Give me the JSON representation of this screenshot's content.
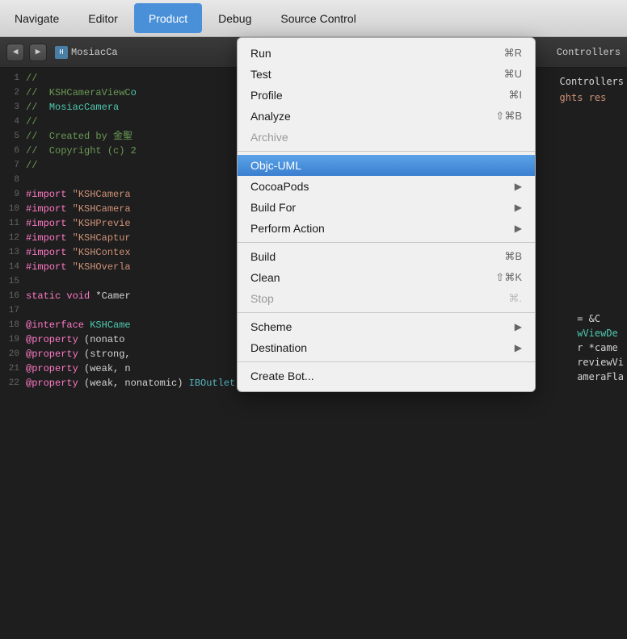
{
  "menubar": {
    "items": [
      {
        "label": "Navigate",
        "active": false
      },
      {
        "label": "Editor",
        "active": false
      },
      {
        "label": "Product",
        "active": true
      },
      {
        "label": "Debug",
        "active": false
      },
      {
        "label": "Source Control",
        "active": false
      }
    ]
  },
  "toolbar": {
    "back_label": "◀",
    "forward_label": "▶",
    "file_label": "MosiacCa",
    "right_label": "Controllers"
  },
  "dropdown": {
    "items": [
      {
        "id": "run",
        "label": "Run",
        "shortcut": "⌘R",
        "has_arrow": false,
        "disabled": false,
        "selected": false,
        "separator_after": false
      },
      {
        "id": "test",
        "label": "Test",
        "shortcut": "⌘U",
        "has_arrow": false,
        "disabled": false,
        "selected": false,
        "separator_after": false
      },
      {
        "id": "profile",
        "label": "Profile",
        "shortcut": "⌘I",
        "has_arrow": false,
        "disabled": false,
        "selected": false,
        "separator_after": false
      },
      {
        "id": "analyze",
        "label": "Analyze",
        "shortcut": "⇧⌘B",
        "has_arrow": false,
        "disabled": false,
        "selected": false,
        "separator_after": false
      },
      {
        "id": "archive",
        "label": "Archive",
        "shortcut": "",
        "has_arrow": false,
        "disabled": true,
        "selected": false,
        "separator_after": true
      },
      {
        "id": "objc-uml",
        "label": "Objc-UML",
        "shortcut": "",
        "has_arrow": false,
        "disabled": false,
        "selected": true,
        "separator_after": false
      },
      {
        "id": "cocoapods",
        "label": "CocoaPods",
        "shortcut": "",
        "has_arrow": true,
        "disabled": false,
        "selected": false,
        "separator_after": false
      },
      {
        "id": "build-for",
        "label": "Build For",
        "shortcut": "",
        "has_arrow": true,
        "disabled": false,
        "selected": false,
        "separator_after": false
      },
      {
        "id": "perform-action",
        "label": "Perform Action",
        "shortcut": "",
        "has_arrow": true,
        "disabled": false,
        "selected": false,
        "separator_after": true
      },
      {
        "id": "build",
        "label": "Build",
        "shortcut": "⌘B",
        "has_arrow": false,
        "disabled": false,
        "selected": false,
        "separator_after": false
      },
      {
        "id": "clean",
        "label": "Clean",
        "shortcut": "⇧⌘K",
        "has_arrow": false,
        "disabled": false,
        "selected": false,
        "separator_after": false
      },
      {
        "id": "stop",
        "label": "Stop",
        "shortcut": "⌘.",
        "has_arrow": false,
        "disabled": true,
        "selected": false,
        "separator_after": true
      },
      {
        "id": "scheme",
        "label": "Scheme",
        "shortcut": "",
        "has_arrow": true,
        "disabled": false,
        "selected": false,
        "separator_after": false
      },
      {
        "id": "destination",
        "label": "Destination",
        "shortcut": "",
        "has_arrow": true,
        "disabled": false,
        "selected": false,
        "separator_after": true
      },
      {
        "id": "create-bot",
        "label": "Create Bot...",
        "shortcut": "",
        "has_arrow": false,
        "disabled": false,
        "selected": false,
        "separator_after": false
      }
    ]
  },
  "code": {
    "lines": [
      {
        "num": "1",
        "content": "//"
      },
      {
        "num": "2",
        "content": "//  KSHCameraViewCo"
      },
      {
        "num": "3",
        "content": "//  MosiacCamera"
      },
      {
        "num": "4",
        "content": "//"
      },
      {
        "num": "5",
        "content": "//  Created by 金聖"
      },
      {
        "num": "6",
        "content": "//  Copyright (c) 2"
      },
      {
        "num": "7",
        "content": "//"
      },
      {
        "num": "8",
        "content": ""
      },
      {
        "num": "9",
        "content": "#import \"KSHCamera"
      },
      {
        "num": "10",
        "content": "#import \"KSHCamera"
      },
      {
        "num": "11",
        "content": "#import \"KSHPrevie"
      },
      {
        "num": "12",
        "content": "#import \"KSHCaptur"
      },
      {
        "num": "13",
        "content": "#import \"KSHContex"
      },
      {
        "num": "14",
        "content": "#import \"KSHOverla"
      },
      {
        "num": "15",
        "content": ""
      },
      {
        "num": "16",
        "content": "static void *Camer"
      },
      {
        "num": "17",
        "content": ""
      },
      {
        "num": "18",
        "content": "@interface KSHCame"
      },
      {
        "num": "19",
        "content": "@property (nonato"
      },
      {
        "num": "20",
        "content": "@property (strong,"
      },
      {
        "num": "21",
        "content": "@property (weak, n"
      },
      {
        "num": "22",
        "content": "@property (weak, nonatomic) IBOutlet UILabel *timerLabe"
      }
    ]
  }
}
